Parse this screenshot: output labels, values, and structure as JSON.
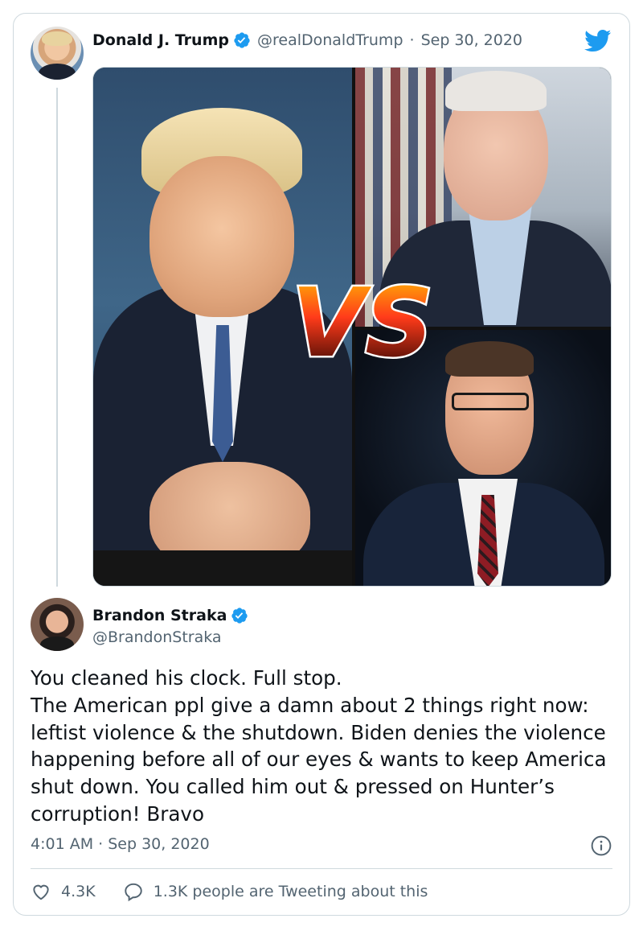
{
  "tweet": {
    "author_name": "Donald J. Trump",
    "author_handle": "@realDonaldTrump",
    "separator": "·",
    "date": "Sep 30, 2020",
    "media": {
      "overlay_text": "VS"
    }
  },
  "reply": {
    "author_name": "Brandon Straka",
    "author_handle": "@BrandonStraka",
    "text": "You cleaned his clock. Full stop.\nThe American ppl give a damn about 2 things right now: leftist violence & the shutdown. Biden denies the violence happening before all of our eyes & wants to keep America shut down. You called him out & pressed on Hunter’s corruption! Bravo",
    "timestamp": "4:01 AM · Sep 30, 2020",
    "likes": "4.3K",
    "tweeting_about": "1.3K people are Tweeting about this"
  },
  "icons": {
    "brand": "twitter-bird-icon",
    "verified": "verified-badge-icon",
    "info": "info-icon",
    "like": "heart-icon",
    "reply": "speech-bubble-icon"
  },
  "colors": {
    "twitter_blue": "#1d9bf0",
    "text": "#0f1419",
    "muted": "#536471",
    "border": "#cfd9de"
  }
}
